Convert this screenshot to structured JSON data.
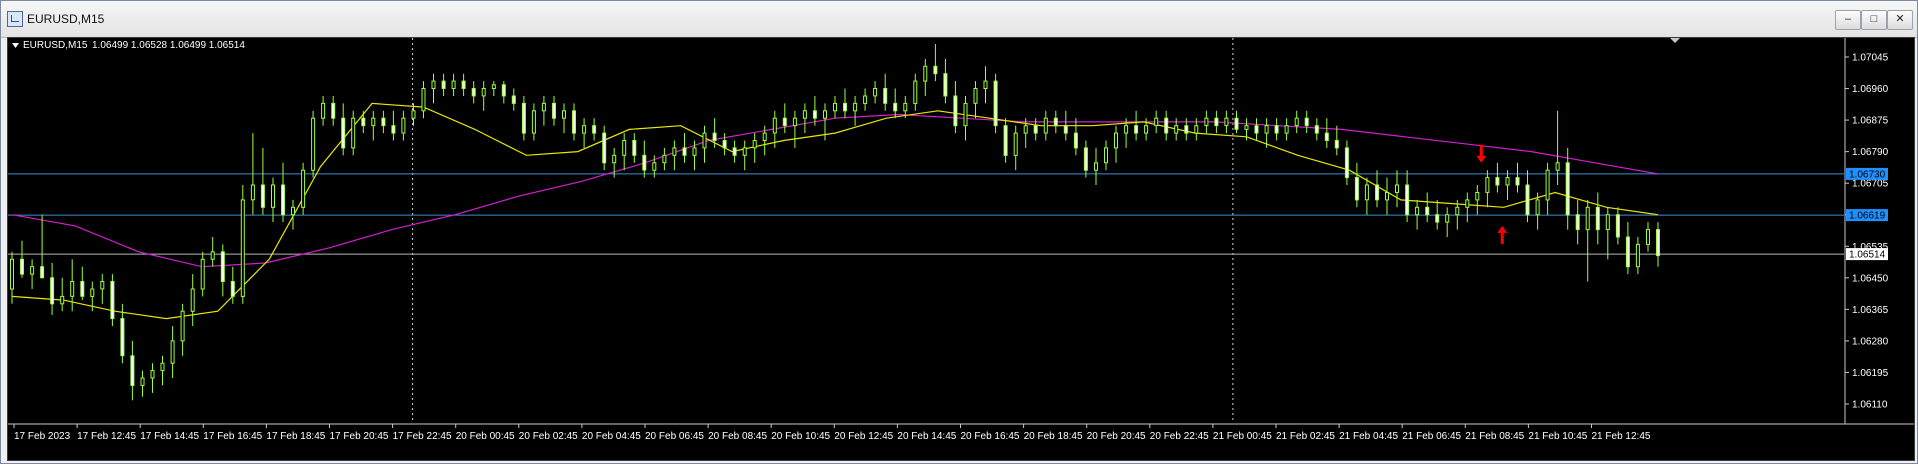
{
  "window": {
    "title": "EURUSD,M15",
    "buttons": {
      "minimize": "–",
      "restore": "□",
      "close": "✕"
    }
  },
  "chart_header": {
    "symbol": "EURUSD,M15",
    "ohlc": "1.06499 1.06528 1.06499 1.06514"
  },
  "colors": {
    "background": "#000000",
    "candle": "#9dff3c",
    "ma_fast": "#e8e800",
    "ma_slow": "#d21fd2",
    "hline": "#3d8fd6",
    "price_tag_blue": "#1e90ff",
    "arrow": "#ff0000"
  },
  "chart_data": {
    "type": "candlestick",
    "symbol": "EURUSD",
    "timeframe": "M15",
    "ylim": [
      1.0611,
      1.0711
    ],
    "price_labels": [
      "1.07045",
      "1.06960",
      "1.06875",
      "1.06790",
      "1.06705",
      "1.06620",
      "1.06535",
      "1.06450",
      "1.06365",
      "1.06280",
      "1.06195",
      "1.06110"
    ],
    "time_labels": [
      "17 Feb 2023",
      "17 Feb 12:45",
      "17 Feb 14:45",
      "17 Feb 16:45",
      "17 Feb 18:45",
      "17 Feb 20:45",
      "17 Feb 22:45",
      "20 Feb 00:45",
      "20 Feb 02:45",
      "20 Feb 04:45",
      "20 Feb 06:45",
      "20 Feb 08:45",
      "20 Feb 10:45",
      "20 Feb 12:45",
      "20 Feb 14:45",
      "20 Feb 16:45",
      "20 Feb 18:45",
      "20 Feb 20:45",
      "20 Feb 22:45",
      "21 Feb 00:45",
      "21 Feb 02:45",
      "21 Feb 04:45",
      "21 Feb 06:45",
      "21 Feb 08:45",
      "21 Feb 10:45",
      "21 Feb 12:45"
    ],
    "horizontal_lines": [
      {
        "price": 1.0673,
        "label": "1.06730"
      },
      {
        "price": 1.06619,
        "label": "1.06619"
      }
    ],
    "current_price": {
      "price": 1.06514,
      "label": "1.06514"
    },
    "period_separators": [
      "17 Feb 22:45",
      "21 Feb 00:45"
    ],
    "ma_fast": [
      1.064,
      1.0639,
      1.0636,
      1.0634,
      1.0636,
      1.065,
      1.0675,
      1.0692,
      1.0691,
      1.0685,
      1.0678,
      1.0679,
      1.0685,
      1.0686,
      1.0679,
      1.0682,
      1.0684,
      1.0688,
      1.069,
      1.0688,
      1.0686,
      1.0686,
      1.0687,
      1.0684,
      1.0683,
      1.0678,
      1.0674,
      1.0666,
      1.0665,
      1.0664,
      1.0668,
      1.0664,
      1.0662
    ],
    "ma_slow": [
      1.0662,
      1.0659,
      1.0652,
      1.0648,
      1.0649,
      1.0653,
      1.0658,
      1.0662,
      1.0667,
      1.0671,
      1.0676,
      1.0682,
      1.0685,
      1.0688,
      1.0689,
      1.0688,
      1.0687,
      1.0687,
      1.0687,
      1.0687,
      1.0686,
      1.0685,
      1.0683,
      1.0681,
      1.0679,
      1.0676,
      1.0673
    ],
    "arrows": [
      {
        "direction": "down",
        "at": "21 Feb 08:45",
        "price": 1.0676
      },
      {
        "direction": "up",
        "at": "21 Feb 08:45",
        "price": 1.0659
      }
    ],
    "candles": [
      [
        1.0642,
        1.0652,
        1.0638,
        1.065
      ],
      [
        1.065,
        1.0655,
        1.0645,
        1.0646
      ],
      [
        1.0646,
        1.065,
        1.0642,
        1.0648
      ],
      [
        1.0648,
        1.0662,
        1.0645,
        1.0645
      ],
      [
        1.0645,
        1.0649,
        1.0635,
        1.0638
      ],
      [
        1.0638,
        1.0645,
        1.0636,
        1.064
      ],
      [
        1.064,
        1.065,
        1.0636,
        1.0644
      ],
      [
        1.0644,
        1.0648,
        1.0639,
        1.064
      ],
      [
        1.064,
        1.0644,
        1.0636,
        1.0642
      ],
      [
        1.0642,
        1.0646,
        1.0638,
        1.0644
      ],
      [
        1.0644,
        1.0646,
        1.0632,
        1.0634
      ],
      [
        1.0634,
        1.0638,
        1.0622,
        1.0624
      ],
      [
        1.0624,
        1.0628,
        1.0612,
        1.0616
      ],
      [
        1.0616,
        1.062,
        1.0613,
        1.0618
      ],
      [
        1.0618,
        1.0622,
        1.0614,
        1.062
      ],
      [
        1.062,
        1.0624,
        1.0616,
        1.0622
      ],
      [
        1.0622,
        1.0632,
        1.0618,
        1.0628
      ],
      [
        1.0628,
        1.0638,
        1.0624,
        1.0636
      ],
      [
        1.0636,
        1.0646,
        1.0632,
        1.0642
      ],
      [
        1.0642,
        1.0652,
        1.064,
        1.065
      ],
      [
        1.065,
        1.0656,
        1.0648,
        1.0652
      ],
      [
        1.0652,
        1.0654,
        1.064,
        1.0644
      ],
      [
        1.0644,
        1.0648,
        1.0638,
        1.064
      ],
      [
        1.064,
        1.067,
        1.0638,
        1.0666
      ],
      [
        1.0666,
        1.0684,
        1.0662,
        1.067
      ],
      [
        1.067,
        1.068,
        1.0662,
        1.0664
      ],
      [
        1.0664,
        1.0672,
        1.066,
        1.067
      ],
      [
        1.067,
        1.0676,
        1.066,
        1.0662
      ],
      [
        1.0662,
        1.0666,
        1.0658,
        1.0664
      ],
      [
        1.0664,
        1.0676,
        1.0662,
        1.0674
      ],
      [
        1.0674,
        1.069,
        1.0672,
        1.0688
      ],
      [
        1.0688,
        1.0694,
        1.0686,
        1.0692
      ],
      [
        1.0692,
        1.0694,
        1.0686,
        1.0688
      ],
      [
        1.0688,
        1.0692,
        1.0678,
        1.068
      ],
      [
        1.068,
        1.069,
        1.0678,
        1.0688
      ],
      [
        1.0688,
        1.069,
        1.0684,
        1.0686
      ],
      [
        1.0686,
        1.069,
        1.0682,
        1.0688
      ],
      [
        1.0688,
        1.069,
        1.0684,
        1.0686
      ],
      [
        1.0686,
        1.069,
        1.0682,
        1.0684
      ],
      [
        1.0684,
        1.069,
        1.0682,
        1.0688
      ],
      [
        1.0688,
        1.0692,
        1.0686,
        1.069
      ],
      [
        1.069,
        1.0698,
        1.0688,
        1.0696
      ],
      [
        1.0696,
        1.07,
        1.0692,
        1.0698
      ],
      [
        1.0698,
        1.07,
        1.0694,
        1.0696
      ],
      [
        1.0696,
        1.07,
        1.0694,
        1.0698
      ],
      [
        1.0698,
        1.07,
        1.0694,
        1.0696
      ],
      [
        1.0696,
        1.0698,
        1.0692,
        1.0694
      ],
      [
        1.0694,
        1.0698,
        1.069,
        1.0696
      ],
      [
        1.0696,
        1.0698,
        1.0694,
        1.0697
      ],
      [
        1.0697,
        1.0698,
        1.0692,
        1.0694
      ],
      [
        1.0694,
        1.0696,
        1.069,
        1.0692
      ],
      [
        1.0692,
        1.0694,
        1.0682,
        1.0684
      ],
      [
        1.0684,
        1.0692,
        1.0682,
        1.069
      ],
      [
        1.069,
        1.0694,
        1.0686,
        1.0692
      ],
      [
        1.0692,
        1.0694,
        1.0686,
        1.0688
      ],
      [
        1.0688,
        1.0692,
        1.0684,
        1.069
      ],
      [
        1.069,
        1.0692,
        1.0682,
        1.0684
      ],
      [
        1.0684,
        1.0688,
        1.068,
        1.0686
      ],
      [
        1.0686,
        1.0688,
        1.0682,
        1.0684
      ],
      [
        1.0684,
        1.0686,
        1.0674,
        1.0676
      ],
      [
        1.0676,
        1.068,
        1.0672,
        1.0678
      ],
      [
        1.0678,
        1.0684,
        1.0674,
        1.0682
      ],
      [
        1.0682,
        1.0684,
        1.0676,
        1.0678
      ],
      [
        1.0678,
        1.0682,
        1.0672,
        1.0674
      ],
      [
        1.0674,
        1.0678,
        1.0672,
        1.0676
      ],
      [
        1.0676,
        1.068,
        1.0674,
        1.0678
      ],
      [
        1.0678,
        1.0682,
        1.0674,
        1.068
      ],
      [
        1.068,
        1.0684,
        1.0676,
        1.0678
      ],
      [
        1.0678,
        1.0682,
        1.0674,
        1.068
      ],
      [
        1.068,
        1.0686,
        1.0676,
        1.0684
      ],
      [
        1.0684,
        1.0688,
        1.068,
        1.0682
      ],
      [
        1.0682,
        1.0684,
        1.0678,
        1.068
      ],
      [
        1.068,
        1.0682,
        1.0676,
        1.0678
      ],
      [
        1.0678,
        1.0682,
        1.0674,
        1.068
      ],
      [
        1.068,
        1.0684,
        1.0676,
        1.0682
      ],
      [
        1.0682,
        1.0686,
        1.0678,
        1.0684
      ],
      [
        1.0684,
        1.069,
        1.068,
        1.0688
      ],
      [
        1.0688,
        1.0692,
        1.0684,
        1.0686
      ],
      [
        1.0686,
        1.069,
        1.068,
        1.0688
      ],
      [
        1.0688,
        1.0692,
        1.0684,
        1.069
      ],
      [
        1.069,
        1.0694,
        1.0686,
        1.0688
      ],
      [
        1.0688,
        1.0692,
        1.0682,
        1.069
      ],
      [
        1.069,
        1.0694,
        1.0688,
        1.0692
      ],
      [
        1.0692,
        1.0696,
        1.0688,
        1.069
      ],
      [
        1.069,
        1.0694,
        1.0686,
        1.0692
      ],
      [
        1.0692,
        1.0696,
        1.069,
        1.0694
      ],
      [
        1.0694,
        1.0698,
        1.0692,
        1.0696
      ],
      [
        1.0696,
        1.07,
        1.069,
        1.0692
      ],
      [
        1.0692,
        1.0696,
        1.0688,
        1.069
      ],
      [
        1.069,
        1.0694,
        1.0688,
        1.0692
      ],
      [
        1.0692,
        1.07,
        1.069,
        1.0698
      ],
      [
        1.0698,
        1.0704,
        1.0694,
        1.0702
      ],
      [
        1.0702,
        1.0708,
        1.0698,
        1.07
      ],
      [
        1.07,
        1.0704,
        1.0692,
        1.0694
      ],
      [
        1.0694,
        1.0698,
        1.0684,
        1.0686
      ],
      [
        1.0686,
        1.0694,
        1.0682,
        1.0692
      ],
      [
        1.0692,
        1.0698,
        1.0688,
        1.0696
      ],
      [
        1.0696,
        1.0702,
        1.0692,
        1.0698
      ],
      [
        1.0698,
        1.07,
        1.0684,
        1.0686
      ],
      [
        1.0686,
        1.0688,
        1.0676,
        1.0678
      ],
      [
        1.0678,
        1.0686,
        1.0674,
        1.0684
      ],
      [
        1.0684,
        1.0688,
        1.068,
        1.0686
      ],
      [
        1.0686,
        1.0688,
        1.0682,
        1.0684
      ],
      [
        1.0684,
        1.069,
        1.0682,
        1.0688
      ],
      [
        1.0688,
        1.069,
        1.0684,
        1.0686
      ],
      [
        1.0686,
        1.069,
        1.0682,
        1.0684
      ],
      [
        1.0684,
        1.0688,
        1.0678,
        1.068
      ],
      [
        1.068,
        1.0682,
        1.0672,
        1.0674
      ],
      [
        1.0674,
        1.068,
        1.067,
        1.0676
      ],
      [
        1.0676,
        1.0682,
        1.0674,
        1.068
      ],
      [
        1.068,
        1.0686,
        1.0676,
        1.0684
      ],
      [
        1.0684,
        1.0688,
        1.068,
        1.0686
      ],
      [
        1.0686,
        1.069,
        1.0682,
        1.0684
      ],
      [
        1.0684,
        1.0688,
        1.0682,
        1.0686
      ],
      [
        1.0686,
        1.069,
        1.0684,
        1.0688
      ],
      [
        1.0688,
        1.069,
        1.0682,
        1.0684
      ],
      [
        1.0684,
        1.0688,
        1.0682,
        1.0686
      ],
      [
        1.0686,
        1.0688,
        1.0682,
        1.0684
      ],
      [
        1.0684,
        1.0688,
        1.0682,
        1.0686
      ],
      [
        1.0686,
        1.069,
        1.0684,
        1.0688
      ],
      [
        1.0688,
        1.069,
        1.0684,
        1.0686
      ],
      [
        1.0686,
        1.069,
        1.0684,
        1.0688
      ],
      [
        1.0688,
        1.069,
        1.0684,
        1.0685
      ],
      [
        1.0685,
        1.0688,
        1.0682,
        1.0686
      ],
      [
        1.0686,
        1.0688,
        1.0682,
        1.0684
      ],
      [
        1.0684,
        1.0688,
        1.068,
        1.0686
      ],
      [
        1.0686,
        1.0688,
        1.0682,
        1.0684
      ],
      [
        1.0684,
        1.0688,
        1.0682,
        1.0686
      ],
      [
        1.0686,
        1.069,
        1.0684,
        1.0688
      ],
      [
        1.0688,
        1.069,
        1.0684,
        1.0686
      ],
      [
        1.0686,
        1.0688,
        1.0682,
        1.0684
      ],
      [
        1.0684,
        1.0688,
        1.068,
        1.0682
      ],
      [
        1.0682,
        1.0686,
        1.0678,
        1.068
      ],
      [
        1.068,
        1.0682,
        1.067,
        1.0672
      ],
      [
        1.0672,
        1.0676,
        1.0664,
        1.0666
      ],
      [
        1.0666,
        1.0672,
        1.0662,
        1.067
      ],
      [
        1.067,
        1.0674,
        1.0664,
        1.0666
      ],
      [
        1.0666,
        1.0672,
        1.0662,
        1.0668
      ],
      [
        1.0668,
        1.0674,
        1.0664,
        1.067
      ],
      [
        1.067,
        1.0674,
        1.066,
        1.0662
      ],
      [
        1.0662,
        1.0666,
        1.0658,
        1.0664
      ],
      [
        1.0664,
        1.0668,
        1.066,
        1.0662
      ],
      [
        1.0662,
        1.0666,
        1.0658,
        1.066
      ],
      [
        1.066,
        1.0664,
        1.0656,
        1.0662
      ],
      [
        1.0662,
        1.0666,
        1.0658,
        1.0664
      ],
      [
        1.0664,
        1.0668,
        1.066,
        1.0666
      ],
      [
        1.0666,
        1.067,
        1.0662,
        1.0668
      ],
      [
        1.0668,
        1.0674,
        1.0664,
        1.0672
      ],
      [
        1.0672,
        1.0676,
        1.0668,
        1.067
      ],
      [
        1.067,
        1.0674,
        1.0666,
        1.0672
      ],
      [
        1.0672,
        1.0676,
        1.0668,
        1.067
      ],
      [
        1.067,
        1.0674,
        1.066,
        1.0662
      ],
      [
        1.0662,
        1.0668,
        1.0658,
        1.0666
      ],
      [
        1.0666,
        1.0676,
        1.0662,
        1.0674
      ],
      [
        1.0674,
        1.069,
        1.067,
        1.0676
      ],
      [
        1.0676,
        1.068,
        1.0658,
        1.0662
      ],
      [
        1.0662,
        1.0666,
        1.0654,
        1.0658
      ],
      [
        1.0658,
        1.0666,
        1.0644,
        1.0664
      ],
      [
        1.0664,
        1.0668,
        1.0654,
        1.0658
      ],
      [
        1.0658,
        1.0664,
        1.065,
        1.0662
      ],
      [
        1.0662,
        1.0664,
        1.0654,
        1.0656
      ],
      [
        1.0656,
        1.066,
        1.0646,
        1.0648
      ],
      [
        1.0648,
        1.0656,
        1.0646,
        1.0654
      ],
      [
        1.0654,
        1.066,
        1.0652,
        1.0658
      ],
      [
        1.0658,
        1.066,
        1.0648,
        1.0651
      ]
    ]
  }
}
